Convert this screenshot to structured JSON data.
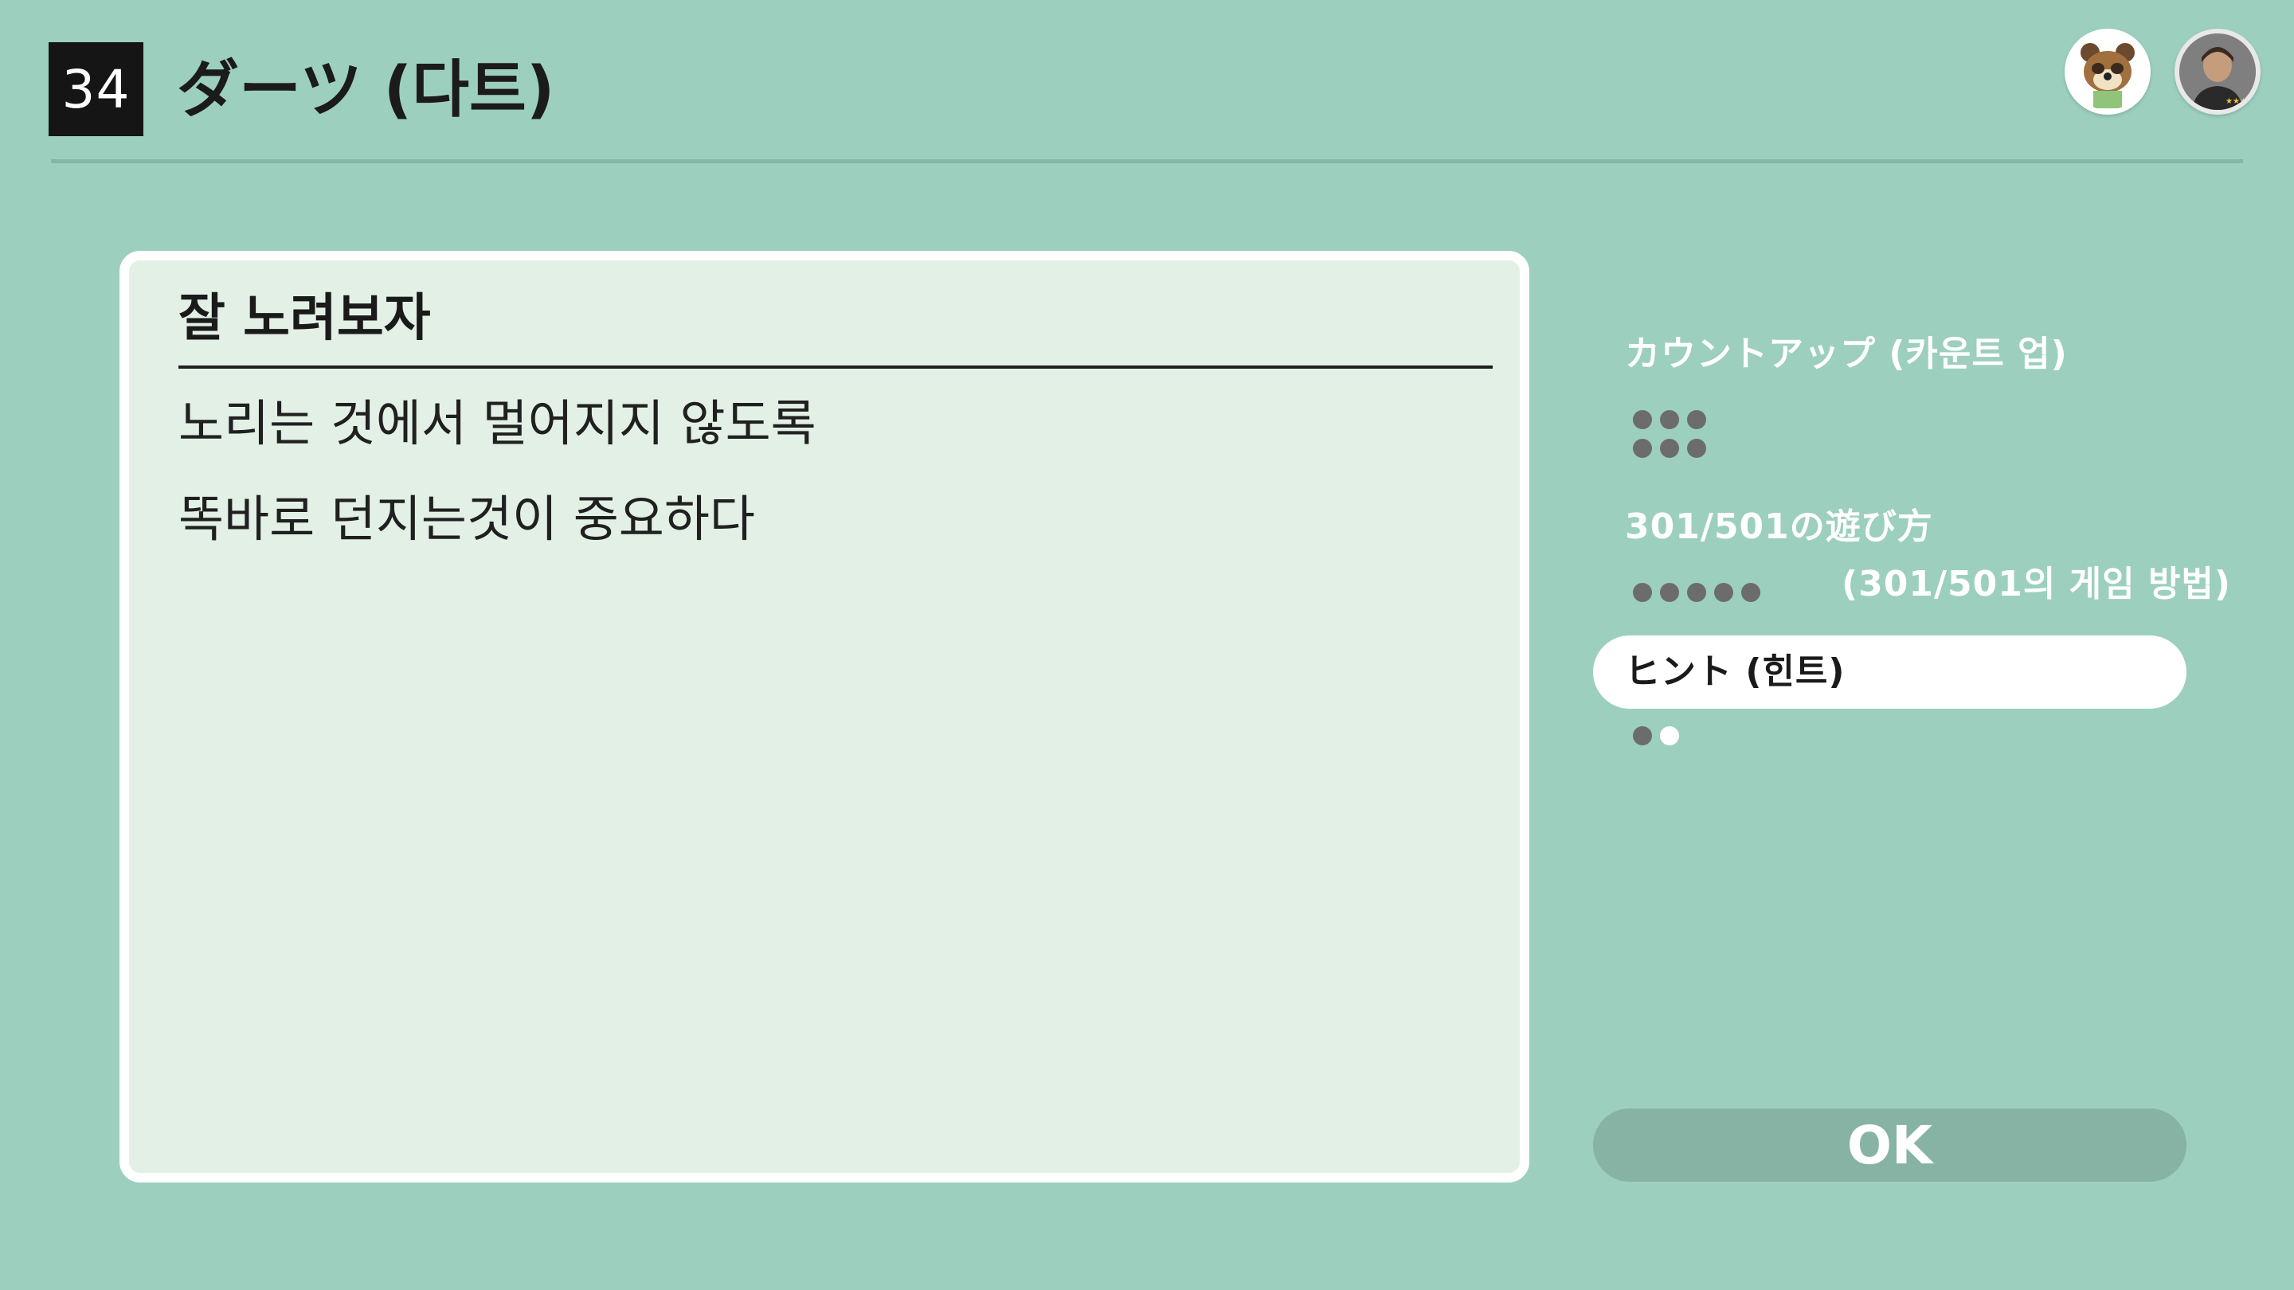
{
  "header": {
    "number": "34",
    "title": "ダーツ (다트)"
  },
  "card": {
    "heading": "잘 노려보자",
    "lines": [
      "노리는 것에서 멀어지지 않도록",
      "똑바로 던지는것이 중요하다"
    ]
  },
  "menu": {
    "items": [
      {
        "label": "カウントアップ (카운트 업)",
        "dots_total": 6,
        "dots_read": 6
      },
      {
        "label": "301/501の遊び方",
        "label_translation": "(301/501의 게임 방법)",
        "dots_total": 5,
        "dots_read": 5
      },
      {
        "label": "ヒント (힌트)",
        "dots_total": 2,
        "dots_read": 1,
        "selected": true
      }
    ]
  },
  "ok_button": {
    "label": "OK"
  },
  "colors": {
    "background": "#9ccfbe",
    "card": "#e3f0e6",
    "badge": "#151515",
    "ok_button": "#86b3a3"
  },
  "avatars": [
    "tom-nook-avatar",
    "player-avatar"
  ]
}
